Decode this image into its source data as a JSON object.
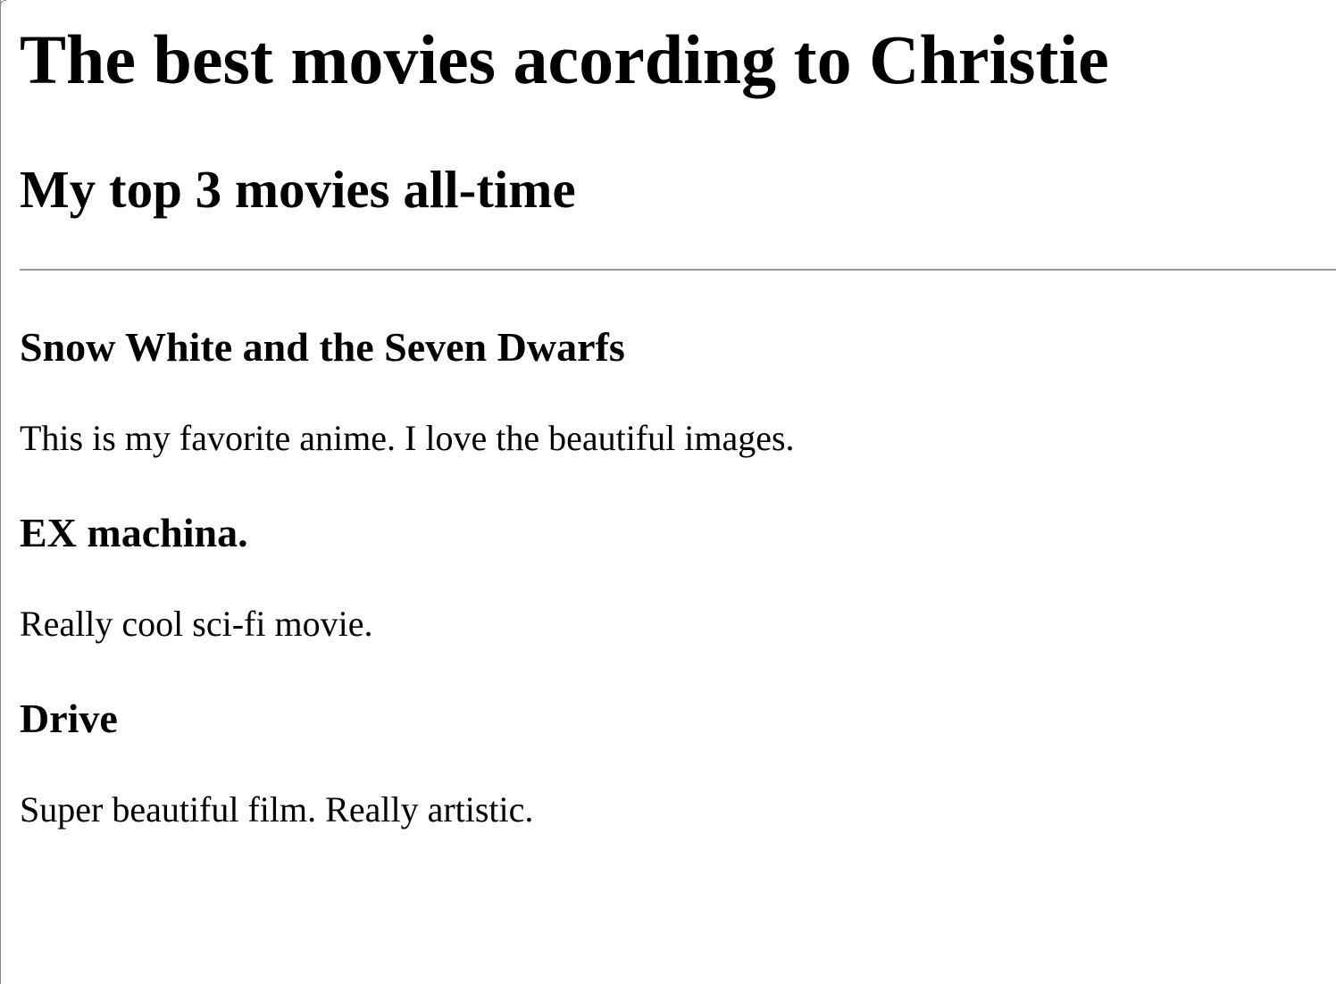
{
  "header": {
    "title": "The best movies acording to Christie",
    "subtitle": "My top 3 movies all-time"
  },
  "movies": [
    {
      "title": "Snow White and the Seven Dwarfs",
      "description": "This is my favorite anime. I love the beautiful images."
    },
    {
      "title": "EX machina.",
      "description": "Really cool sci-fi movie."
    },
    {
      "title": "Drive",
      "description": "Super beautiful film. Really artistic."
    }
  ]
}
